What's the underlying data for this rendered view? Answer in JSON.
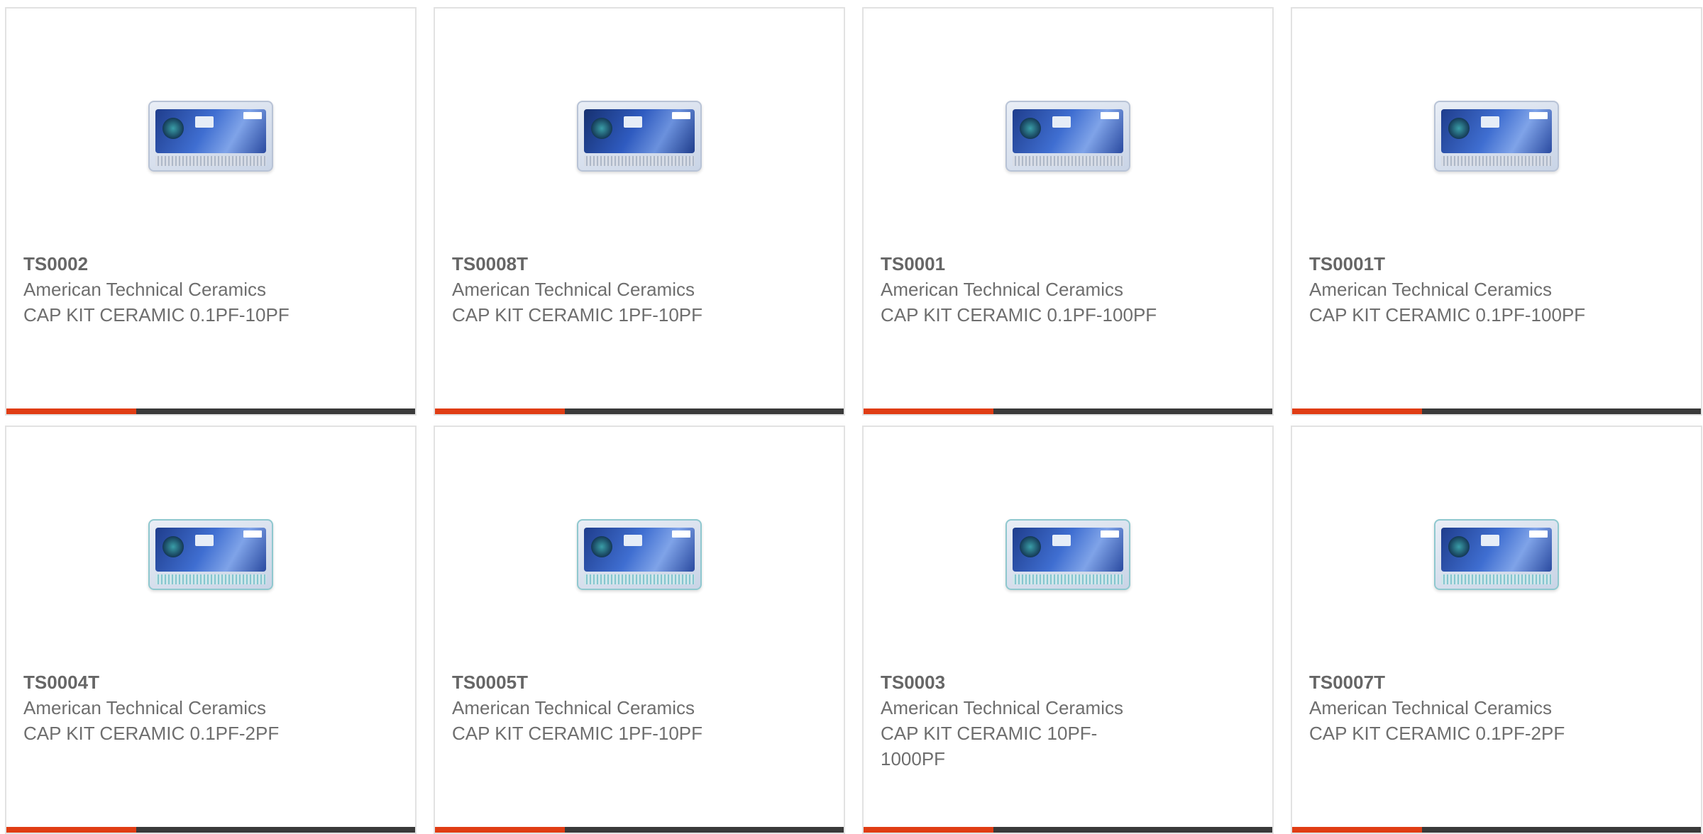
{
  "products": [
    {
      "part_number": "TS0002",
      "manufacturer": "American Technical Ceramics",
      "description": "CAP KIT CERAMIC 0.1PF-10PF",
      "image_icon": "capacitor-kit-image"
    },
    {
      "part_number": "TS0008T",
      "manufacturer": "American Technical Ceramics",
      "description": "CAP KIT CERAMIC 1PF-10PF",
      "image_icon": "capacitor-kit-image"
    },
    {
      "part_number": "TS0001",
      "manufacturer": "American Technical Ceramics",
      "description": "CAP KIT CERAMIC 0.1PF-100PF",
      "image_icon": "capacitor-kit-image"
    },
    {
      "part_number": "TS0001T",
      "manufacturer": "American Technical Ceramics",
      "description": "CAP KIT CERAMIC 0.1PF-100PF",
      "image_icon": "capacitor-kit-image"
    },
    {
      "part_number": "TS0004T",
      "manufacturer": "American Technical Ceramics",
      "description": "CAP KIT CERAMIC 0.1PF-2PF",
      "image_icon": "capacitor-kit-image"
    },
    {
      "part_number": "TS0005T",
      "manufacturer": "American Technical Ceramics",
      "description": "CAP KIT CERAMIC 1PF-10PF",
      "image_icon": "capacitor-kit-image"
    },
    {
      "part_number": "TS0003",
      "manufacturer": "American Technical Ceramics",
      "description": "CAP KIT CERAMIC 10PF-1000PF",
      "image_icon": "capacitor-kit-image"
    },
    {
      "part_number": "TS0007T",
      "manufacturer": "American Technical Ceramics",
      "description": "CAP KIT CERAMIC 0.1PF-2PF",
      "image_icon": "capacitor-kit-image"
    }
  ],
  "colors": {
    "accent": "#e03d14",
    "bar": "#3a3a3a",
    "text": "#6e6e6e",
    "border": "#e2e2e2"
  }
}
